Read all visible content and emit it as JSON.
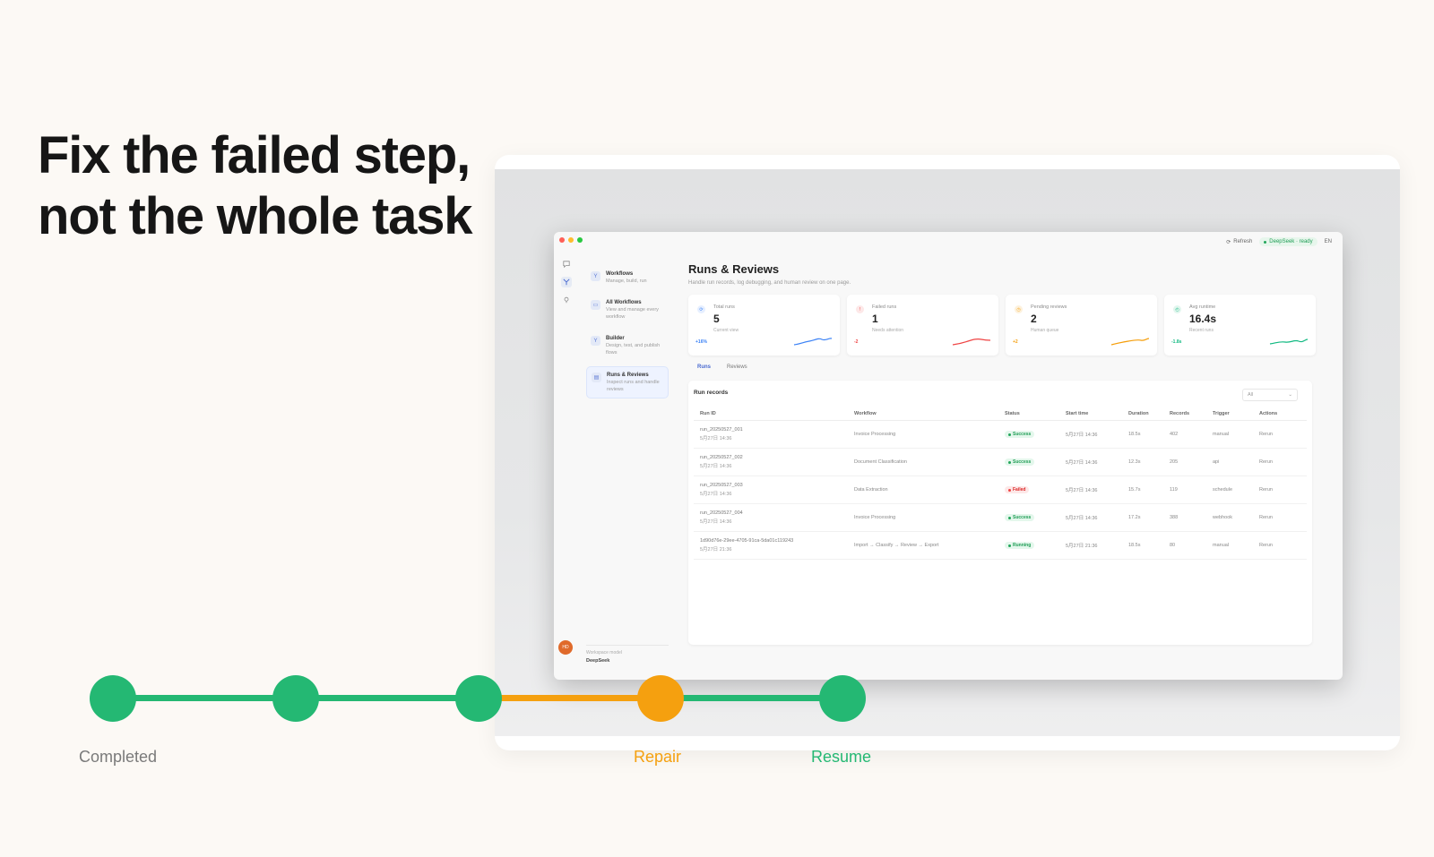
{
  "headline": {
    "line1": "Fix the failed step,",
    "line2": "not the whole task"
  },
  "colors": {
    "green": "#24b873",
    "orange": "#f5a00f",
    "gray_text": "#7a7a7a"
  },
  "window": {
    "topbar": {
      "refresh_label": "Refresh",
      "model_status": "DeepSeek · ready",
      "lang": "EN"
    },
    "rail_icons": [
      "chat-icon",
      "workflow-icon",
      "pin-icon"
    ],
    "nav": [
      {
        "icon": "workflow-icon",
        "title": "Workflows",
        "subtitle": "Manage, build, run",
        "active": false
      },
      {
        "icon": "folder-icon",
        "title": "All Workflows",
        "subtitle": "View and manage every workflow",
        "active": false
      },
      {
        "icon": "builder-icon",
        "title": "Builder",
        "subtitle": "Design, test, and publish flows",
        "active": false
      },
      {
        "icon": "document-icon",
        "title": "Runs & Reviews",
        "subtitle": "Inspect runs and handle reviews",
        "active": true
      }
    ],
    "avatar_initials": "HD",
    "workspace": {
      "label": "Workspace model",
      "value": "DeepSeek"
    },
    "page": {
      "title": "Runs & Reviews",
      "subtitle": "Handle run records, log debugging, and human review on one page."
    },
    "stats": [
      {
        "label": "Total runs",
        "value": "5",
        "caption": "Current view",
        "delta": "+16%",
        "color": "#3b82f6",
        "icon": "refresh-icon"
      },
      {
        "label": "Failed runs",
        "value": "1",
        "caption": "Needs attention",
        "delta": "-2",
        "color": "#ef4444",
        "icon": "alert-icon"
      },
      {
        "label": "Pending reviews",
        "value": "2",
        "caption": "Human queue",
        "delta": "+2",
        "color": "#f59e0b",
        "icon": "clock-icon"
      },
      {
        "label": "Avg runtime",
        "value": "16.4s",
        "caption": "Recent runs",
        "delta": "-1.8s",
        "color": "#10b981",
        "icon": "timer-icon"
      }
    ],
    "tabs": [
      "Runs",
      "Reviews"
    ],
    "records": {
      "title": "Run records",
      "filter_value": "All",
      "columns": [
        "Run ID",
        "Workflow",
        "Status",
        "Start time",
        "Duration",
        "Records",
        "Trigger",
        "Actions"
      ],
      "rows": [
        {
          "run_id": "run_20250527_001",
          "time": "5月27日 14:36",
          "workflow": "Invoice Processing",
          "status": "Success",
          "start": "5月27日 14:36",
          "duration": "18.5s",
          "records": "402",
          "trigger": "manual",
          "action": "Rerun"
        },
        {
          "run_id": "run_20250527_002",
          "time": "5月27日 14:36",
          "workflow": "Document Classification",
          "status": "Success",
          "start": "5月27日 14:36",
          "duration": "12.3s",
          "records": "205",
          "trigger": "api",
          "action": "Rerun"
        },
        {
          "run_id": "run_20250527_003",
          "time": "5月27日 14:36",
          "workflow": "Data Extraction",
          "status": "Failed",
          "start": "5月27日 14:36",
          "duration": "15.7s",
          "records": "119",
          "trigger": "schedule",
          "action": "Rerun"
        },
        {
          "run_id": "run_20250527_004",
          "time": "5月27日 14:36",
          "workflow": "Invoice Processing",
          "status": "Success",
          "start": "5月27日 14:36",
          "duration": "17.2s",
          "records": "388",
          "trigger": "webhook",
          "action": "Rerun"
        },
        {
          "run_id": "1d90d76e-29ee-4705-91ca-5da01c119243",
          "time": "5月27日 21:36",
          "workflow": "Import → Classify → Review → Export",
          "status": "Running",
          "start": "5月27日 21:36",
          "duration": "18.5s",
          "records": "80",
          "trigger": "manual",
          "action": "Rerun"
        }
      ]
    }
  },
  "timeline": {
    "labels": {
      "completed": "Completed",
      "repair": "Repair",
      "resume": "Resume"
    },
    "steps": [
      "completed",
      "completed",
      "completed",
      "repair",
      "resume"
    ]
  }
}
